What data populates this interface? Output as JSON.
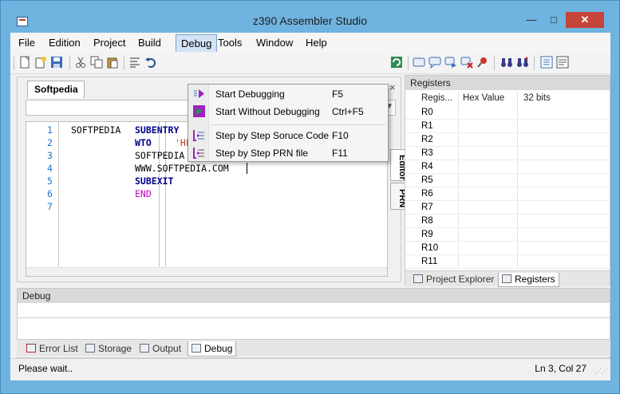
{
  "window": {
    "title": "z390 Assembler Studio",
    "minimize_glyph": "—",
    "maximize_glyph": "□",
    "close_glyph": "✕"
  },
  "menubar": {
    "items": [
      "File",
      "Edition",
      "Project",
      "Build",
      "Debug",
      "Tools",
      "Window",
      "Help"
    ],
    "active": "Debug"
  },
  "toolbar": {
    "icons": [
      "new-file-icon",
      "new-project-icon",
      "save-icon",
      "cut-icon",
      "copy-icon",
      "paste-icon",
      "align-icon",
      "undo-icon",
      "refresh-icon",
      "window-icon",
      "speech-icon",
      "forward-icon",
      "stop-icon",
      "pin-icon",
      "binoculars-icon",
      "binoculars-next-icon",
      "list-icon",
      "properties-icon"
    ]
  },
  "document": {
    "tab": "Softpedia",
    "close_glyph": "×",
    "vertical_tabs": [
      "Editor",
      "PRN"
    ],
    "lines": [
      {
        "num": "1",
        "label": "SOFTPEDIA",
        "op": "SUBENTRY",
        "operand": ""
      },
      {
        "num": "2",
        "label": "",
        "op": "WTO",
        "operand": "'HELLO WORLD'"
      },
      {
        "num": "3",
        "label": "",
        "op": "SOFTPEDIA TEST",
        "operand": ""
      },
      {
        "num": "4",
        "label": "",
        "op": "WWW.SOFTPEDIA.COM",
        "operand": ""
      },
      {
        "num": "5",
        "label": "",
        "op": "SUBEXIT",
        "operand": ""
      },
      {
        "num": "6",
        "label": "",
        "op": "END",
        "operand": ""
      },
      {
        "num": "7",
        "label": "",
        "op": "",
        "operand": ""
      }
    ]
  },
  "debug_menu": {
    "items": [
      {
        "label": "Start Debugging",
        "shortcut": "F5"
      },
      {
        "label": "Start Without Debugging",
        "shortcut": "Ctrl+F5"
      },
      {
        "label": "Step by Step Soruce Code",
        "shortcut": "F10"
      },
      {
        "label": "Step by Step PRN file",
        "shortcut": "F11"
      }
    ]
  },
  "registers": {
    "title": "Registers",
    "columns": [
      "Regis...",
      "Hex Value",
      "32 bits"
    ],
    "rows": [
      "R0",
      "R1",
      "R2",
      "R3",
      "R4",
      "R5",
      "R6",
      "R7",
      "R8",
      "R9",
      "R10",
      "R11"
    ],
    "tabs": [
      "Project Explorer",
      "Registers"
    ],
    "active_tab": "Registers"
  },
  "debug_panel": {
    "title": "Debug"
  },
  "bottom_tabs": {
    "items": [
      "Error List",
      "Storage",
      "Output",
      "Debug"
    ],
    "active": "Debug"
  },
  "status": {
    "left": "Please wait..",
    "right": "Ln 3, Col 27"
  },
  "colors": {
    "line_number": "#1a73c9",
    "keyword": "#00008b",
    "string": "#b04020",
    "macro": "#c000c0",
    "title_bar": "#6fb3e0",
    "close_button": "#c7443a"
  }
}
